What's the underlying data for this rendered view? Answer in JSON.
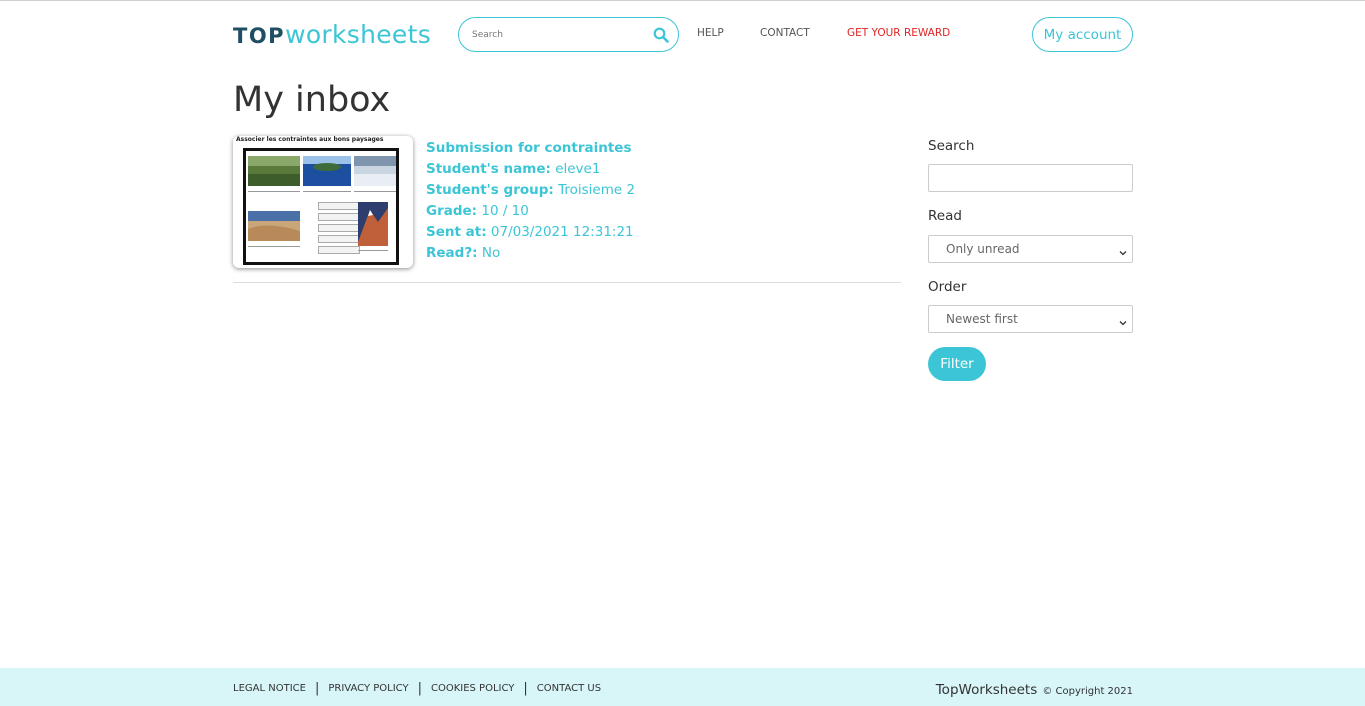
{
  "header": {
    "logo_top": "TOP",
    "logo_ws": "worksheets",
    "search_placeholder": "Search",
    "nav": {
      "help": "HELP",
      "contact": "CONTACT",
      "reward": "GET YOUR REWARD"
    },
    "account": "My account"
  },
  "page": {
    "title": "My inbox"
  },
  "submission": {
    "thumbnail_title": "Associer les contraintes aux bons paysages",
    "title": "Submission for contraintes",
    "fields": [
      {
        "label": "Student's name:",
        "value": "eleve1"
      },
      {
        "label": "Student's group:",
        "value": "Troisieme 2"
      },
      {
        "label": "Grade:",
        "value": "10 / 10"
      },
      {
        "label": "Sent at:",
        "value": "07/03/2021 12:31:21"
      },
      {
        "label": "Read?:",
        "value": "No"
      }
    ]
  },
  "sidebar": {
    "search_label": "Search",
    "search_value": "",
    "read_label": "Read",
    "read_selected": "Only unread",
    "order_label": "Order",
    "order_selected": "Newest first",
    "filter_button": "Filter"
  },
  "footer": {
    "links": [
      "LEGAL NOTICE",
      "PRIVACY POLICY",
      "COOKIES POLICY",
      "CONTACT US"
    ],
    "separator": "|",
    "brand": "TopWorksheets",
    "copyright": "© Copyright 2021"
  },
  "colors": {
    "accent": "#3cc5d6",
    "reward": "#e02424",
    "footer_bg": "#d8f5f8"
  },
  "icons": {
    "search": "search-icon",
    "select_caret": "chevron-down-icon"
  }
}
